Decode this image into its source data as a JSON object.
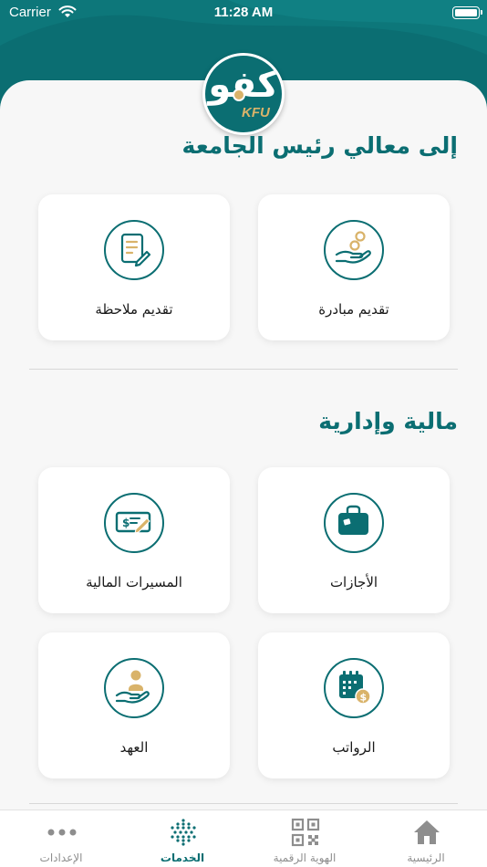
{
  "status_bar": {
    "carrier": "Carrier",
    "time": "11:28 AM"
  },
  "logo": {
    "arabic": "كفو",
    "english": "KFU"
  },
  "sections": [
    {
      "title": "إلى معالي رئيس الجامعة",
      "cards": [
        {
          "label": "تقديم مبادرة",
          "icon": "hand-coins-icon"
        },
        {
          "label": "تقديم ملاحظة",
          "icon": "note-edit-icon"
        }
      ]
    },
    {
      "title": "مالية وإدارية",
      "cards": [
        {
          "label": "الأجازات",
          "icon": "suitcase-icon"
        },
        {
          "label": "المسيرات المالية",
          "icon": "cheque-icon"
        },
        {
          "label": "الرواتب",
          "icon": "salary-calendar-icon"
        },
        {
          "label": "العهد",
          "icon": "custody-person-icon"
        }
      ]
    }
  ],
  "tab_bar": {
    "tabs": [
      {
        "label": "الرئيسية",
        "icon": "home-icon",
        "active": false
      },
      {
        "label": "الهوية الرقمية",
        "icon": "qr-code-icon",
        "active": false
      },
      {
        "label": "الخدمات",
        "icon": "services-grid-icon",
        "active": true
      },
      {
        "label": "الإعدادات",
        "icon": "more-dots-icon",
        "active": false
      }
    ]
  },
  "colors": {
    "primary": "#0b6e72",
    "accent": "#d9b36a",
    "background": "#f7f7f7"
  }
}
